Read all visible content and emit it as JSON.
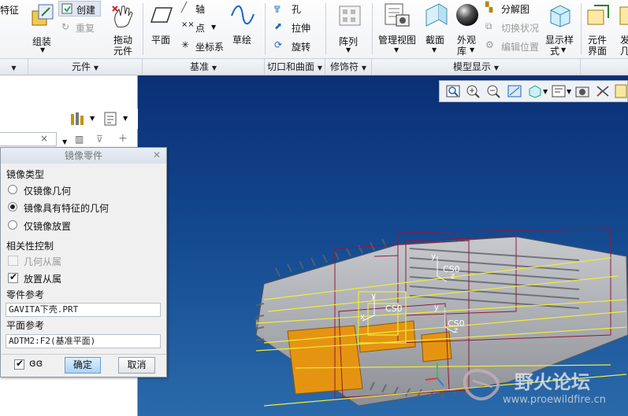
{
  "ribbon": {
    "cut_label": "特征",
    "assemble_label": "组装",
    "create_label": "创建",
    "repeat_label": "重复",
    "drag_label": "拖动",
    "drag_label2": "元件",
    "plane_label": "平面",
    "axis_label": "轴",
    "point_label": "点",
    "csys_label": "坐标系",
    "sketch_label": "草绘",
    "hole_label": "孔",
    "extrude_label": "拉伸",
    "revolve_label": "旋转",
    "pattern_label": "阵列",
    "manage_views_label": "管理视图",
    "section_label": "截面",
    "appearance_label": "外观",
    "appearance_label2": "库",
    "explode_label": "分解图",
    "toggle_status_label": "切换状况",
    "edit_position_label": "编辑位置",
    "display_style_label": "显示样",
    "display_style_label2": "式",
    "component_ui_label": "元件",
    "component_ui_label2": "界面",
    "publish_label": "发",
    "publish_label2": "几",
    "groups": {
      "components": "元件",
      "datum": "基准",
      "cuts_surfaces": "切口和曲面",
      "modifiers": "修饰符",
      "model_display": "模型显示"
    }
  },
  "dialog": {
    "title": "镜像零件",
    "mirror_type_label": "镜像类型",
    "options": [
      "仅镜像几何",
      "镜像具有特征的几何",
      "仅镜像放置"
    ],
    "selected_option": 1,
    "dependency_label": "相关性控制",
    "geometry_dependent": "几何从属",
    "placement_dependent": "放置从属",
    "part_ref_label": "零件参考",
    "part_ref_value": "GAVITA下壳.PRT",
    "plane_ref_label": "平面参考",
    "plane_ref_value": "ADTM2:F2(基准平面)",
    "ok": "确定",
    "cancel": "取消"
  },
  "viewport": {
    "labels": {
      "csys1": "CS0",
      "csys2": "CS0",
      "csys3": "CS0",
      "y1": "y",
      "z1": "z",
      "y2": "y",
      "x2": "x",
      "y3": "y",
      "z3": "z"
    },
    "watermark": "野火论坛",
    "watermark_url": "www.proewildfire.cn"
  }
}
